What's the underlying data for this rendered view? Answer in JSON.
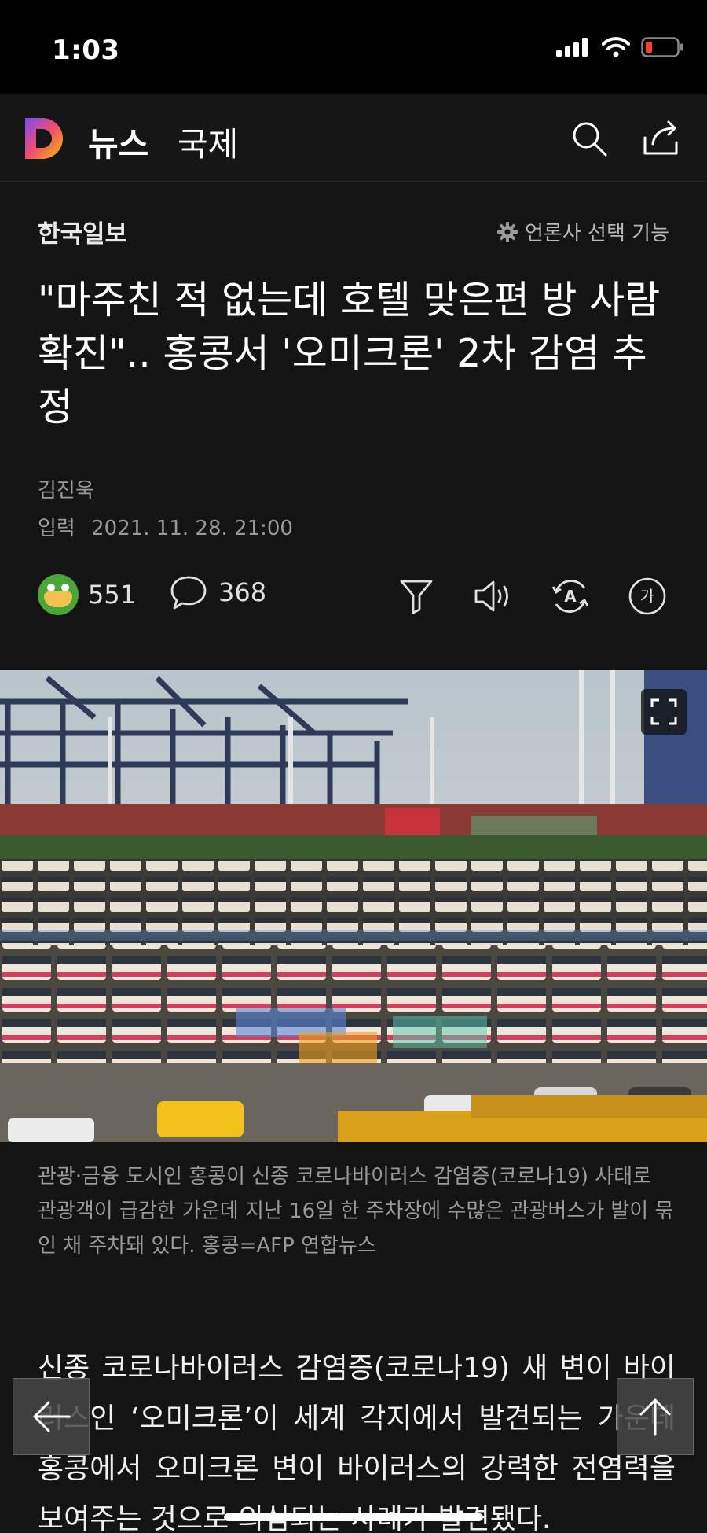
{
  "status": {
    "time": "1:03"
  },
  "header": {
    "brand": "뉴스",
    "section": "국제",
    "logo_letter": "D"
  },
  "article": {
    "publisher": "한국일보",
    "publisher_select_label": "언론사 선택 기능",
    "headline": "\"마주친 적 없는데 호텔 맞은편 방 사람 확진\".. 홍콩서 '오미크론' 2차 감염 추정",
    "author": "김진욱",
    "date_label": "입력",
    "date": "2021. 11. 28. 21:00",
    "reaction_count": "551",
    "comment_count": "368",
    "caption": "관광·금융 도시인 홍콩이 신종 코로나바이러스 감염증(코로나19) 사태로 관광객이 급감한 가운데 지난 16일 한 주차장에 수많은 관광버스가 발이 묶인 채 주차돼 있다. 홍콩=AFP 연합뉴스",
    "body": "신종 코로나바이러스 감염증(코로나19) 새 변이 바이러스인 ‘오미크론’이 세계 각지에서 발견되는 가운데 홍콩에서 오미크론 변이 바이러스의 강력한 전염력을 보여주는 것으로 의심되는 사례가 발견됐다."
  },
  "icons": {
    "search": "search-icon",
    "share": "share-icon",
    "settings": "gear-icon",
    "comment": "comment-icon",
    "summary": "funnel-icon",
    "tts": "speaker-icon",
    "translate": "translate-icon",
    "font": "font-size-icon",
    "expand": "expand-icon",
    "back": "arrow-left-icon",
    "top": "arrow-up-icon"
  },
  "colors": {
    "background": "#141414",
    "status_bar": "#000000",
    "battery_low": "#ff3b30",
    "logo_yellow": "#f6c100",
    "logo_purple": "#7a4cf2"
  }
}
